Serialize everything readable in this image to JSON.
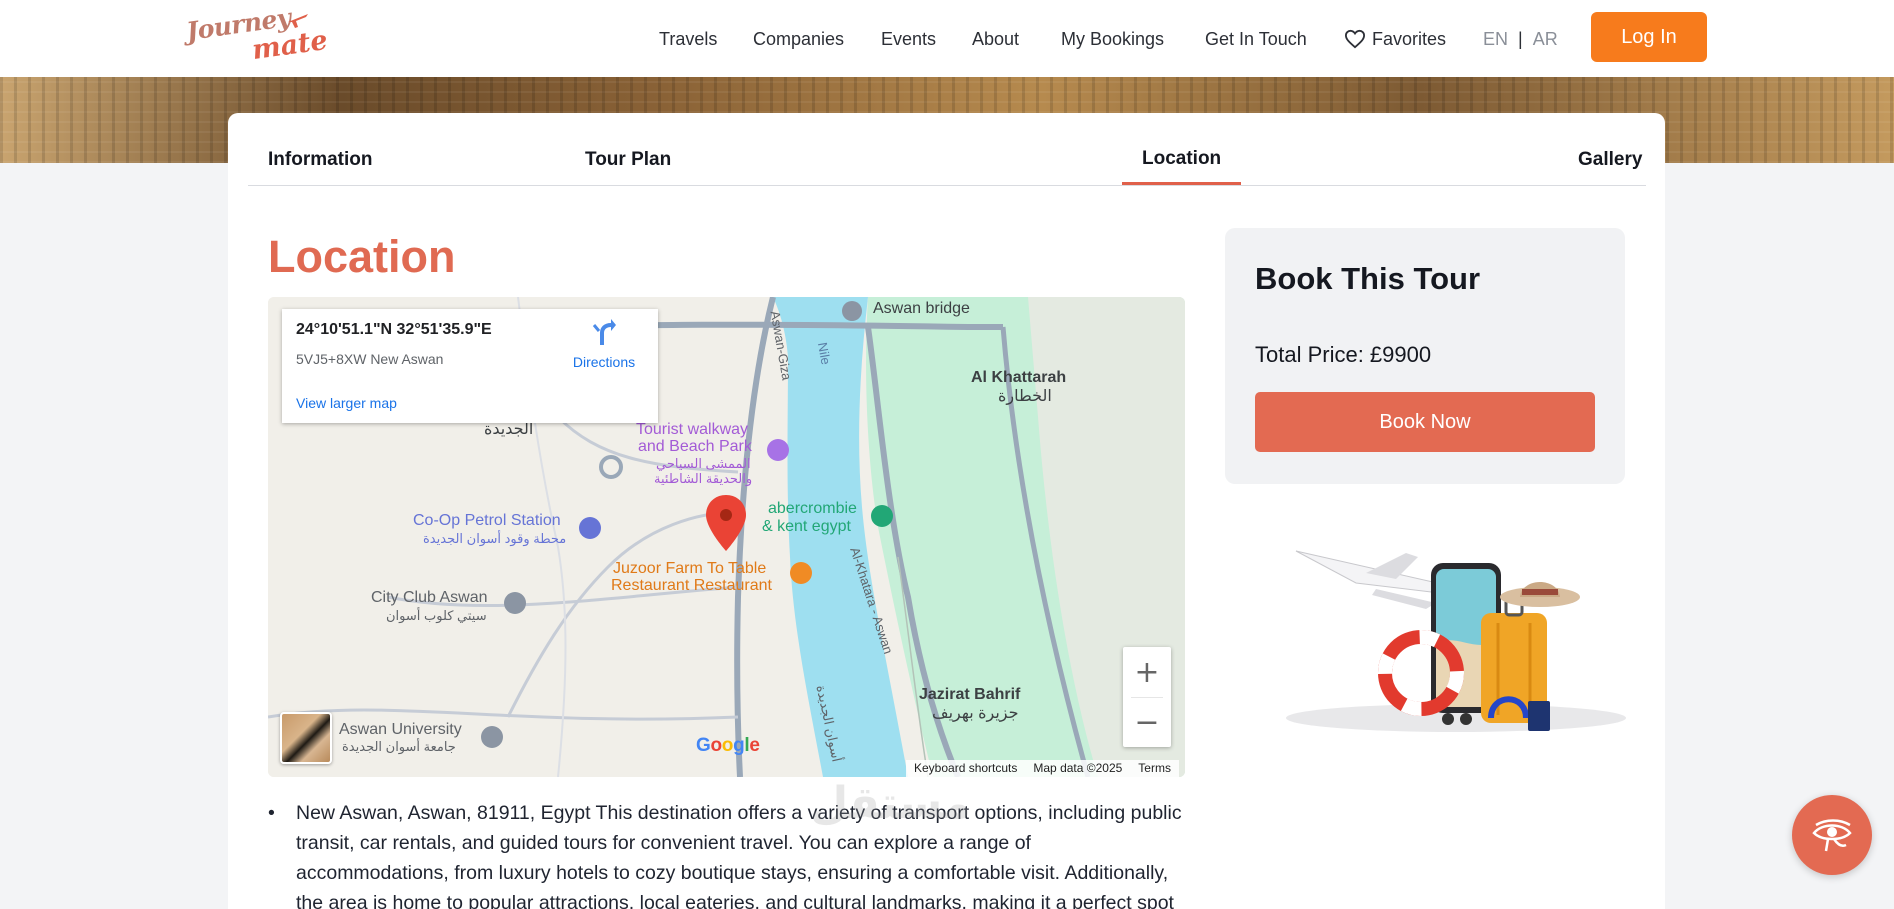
{
  "brand": {
    "logo_line1": "Journey",
    "logo_line2": "mate"
  },
  "nav": {
    "travels": "Travels",
    "companies": "Companies",
    "events": "Events",
    "about": "About",
    "my_bookings": "My Bookings",
    "get_in_touch": "Get In Touch",
    "favorites": "Favorites",
    "lang_en": "EN",
    "lang_sep": "|",
    "lang_ar": "AR",
    "login": "Log In"
  },
  "tabs": {
    "information": "Information",
    "tour_plan": "Tour Plan",
    "location": "Location",
    "gallery": "Gallery",
    "active": "Location"
  },
  "location": {
    "title": "Location",
    "map": {
      "coords": "24°10'51.1\"N 32°51'35.9\"E",
      "plus_code": "5VJ5+8XW New Aswan",
      "directions": "Directions",
      "view_larger": "View larger map",
      "labels": {
        "aswan_bridge": "Aswan bridge",
        "nile": "Nile",
        "aswan_giza": "Aswan-Giza",
        "al_khattarah": "Al Khattarah",
        "al_khattarah_ar": "الخطارة",
        "new_ar": "الجديدة",
        "tourist_walkway_1": "Tourist walkway",
        "tourist_walkway_2": "and Beach Park",
        "tourist_walkway_ar1": "الممشى السياحي",
        "tourist_walkway_ar2": "والحديقة الشاطئية",
        "abercrombie_1": "abercrombie",
        "abercrombie_2": "& kent egypt",
        "coop_1": "Co-Op Petrol Station",
        "coop_ar": "محطة وقود أسوان الجديدة",
        "juzoor_1": "Juzoor Farm To Table",
        "juzoor_2": "Restaurant Restaurant",
        "city_club": "City Club Aswan",
        "city_club_ar": "سيتي كلوب أسوان",
        "al_khatara_aswan": "Al-Khatara - Aswan",
        "jazirat_bahrif": "Jazirat Bahrif",
        "jazirat_bahrif_ar": "جزيرة بهريف",
        "aswan_university": "Aswan University",
        "aswan_university_ar": "جامعة أسوان الجديدة",
        "road_ar": "أسوان الجديدة"
      },
      "zoom_in": "+",
      "zoom_out": "−",
      "google": "Google",
      "keyboard_shortcuts": "Keyboard shortcuts",
      "map_data": "Map data ©2025",
      "terms": "Terms"
    },
    "description": "New Aswan, Aswan, 81911, Egypt This destination offers a variety of transport options, including public transit, car rentals, and guided tours for convenient travel. You can explore a range of accommodations, from luxury hotels to cozy boutique stays, ensuring a comfortable visit. Additionally, the area is home to popular attractions, local eateries, and cultural landmarks, making it a perfect spot"
  },
  "booking": {
    "title": "Book This Tour",
    "total_price": "Total Price: £9900",
    "book_now": "Book Now"
  },
  "watermark": "مستقل",
  "colors": {
    "accent": "#e36a52",
    "login": "#f77b1c",
    "water": "#9edff0",
    "park": "#c6efd8"
  }
}
